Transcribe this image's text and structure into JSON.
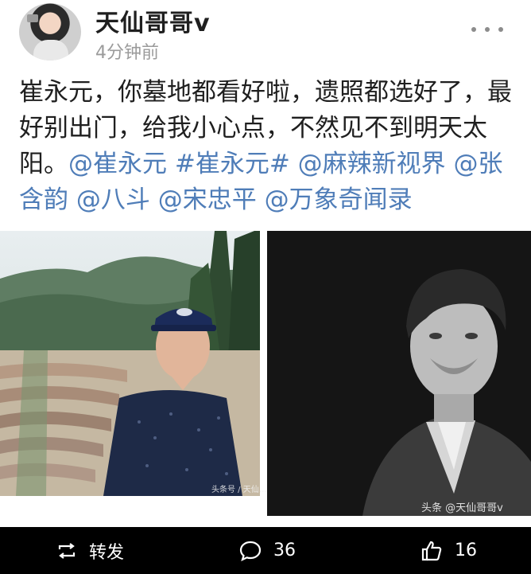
{
  "header": {
    "username": "天仙哥哥v",
    "timestamp": "4分钟前"
  },
  "post": {
    "segments": [
      {
        "text": "崔永元，你墓地都看好啦，遗照都选好了，最好别出门，给我小心点，不然见不到明天太阳。",
        "link": false
      },
      {
        "text": "@崔永元",
        "link": true
      },
      {
        "text": " ",
        "link": false
      },
      {
        "text": "#崔永元#",
        "link": true
      },
      {
        "text": " ",
        "link": false
      },
      {
        "text": "@麻辣新视界",
        "link": true
      },
      {
        "text": " ",
        "link": false
      },
      {
        "text": "@张含韵",
        "link": true
      },
      {
        "text": " ",
        "link": false
      },
      {
        "text": "@八斗",
        "link": true
      },
      {
        "text": " ",
        "link": false
      },
      {
        "text": "@宋忠平",
        "link": true
      },
      {
        "text": " ",
        "link": false
      },
      {
        "text": "@万象奇闻录",
        "link": true
      }
    ]
  },
  "images": {
    "left_watermark": "头条号 / 天仙…",
    "right_watermark": "头条 @天仙哥哥v"
  },
  "actions": {
    "repost_label": "转发",
    "comment_count": "36",
    "like_count": "16"
  },
  "colors": {
    "link": "#4f7db8",
    "text": "#1f1f1f",
    "meta": "#9b9b9b",
    "action_bar": "#000000"
  }
}
